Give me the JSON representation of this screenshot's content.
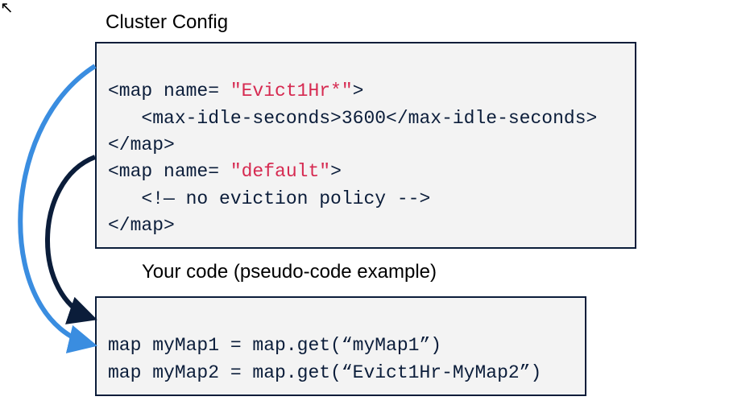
{
  "headings": {
    "config": "Cluster Config",
    "code": "Your code (pseudo-code example)"
  },
  "xml": {
    "map1_open_a": "<map name= ",
    "map1_open_b": "\"Evict1Hr*\"",
    "map1_open_c": ">",
    "map1_body": "   <max-idle-seconds>3600</max-idle-seconds>",
    "map_close": "</map>",
    "map2_open_a": "<map name= ",
    "map2_open_b": "\"default\"",
    "map2_open_c": ">",
    "map2_body": "   <!— no eviction policy -->"
  },
  "code": {
    "line1": "map myMap1 = map.get(“myMap1”)",
    "line2": "map myMap2 = map.get(“Evict1Hr-MyMap2”)"
  },
  "colors": {
    "dark": "#0b1d3a",
    "light": "#3a8de0"
  }
}
